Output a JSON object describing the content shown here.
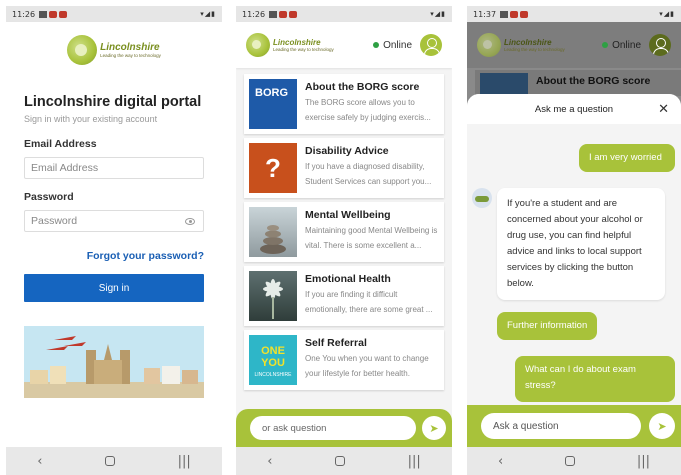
{
  "colors": {
    "brand_green": "#a8c23a",
    "primary_blue": "#1565c0",
    "link_blue": "#1a5fb4",
    "online_green": "#2ea043"
  },
  "logo": {
    "name": "Lincolnshire",
    "tagline": "Leading the way to technology"
  },
  "nav_icons": [
    "back-icon",
    "home-icon",
    "recents-icon"
  ],
  "screen1": {
    "status_time": "11:26",
    "title": "Lincolnshire digital portal",
    "subtitle": "Sign in with your existing account",
    "email_label": "Email Address",
    "email_placeholder": "Email Address",
    "password_label": "Password",
    "password_placeholder": "Password",
    "forgot_link": "Forgot your password?",
    "signin_button": "Sign in"
  },
  "screen2": {
    "status_time": "11:26",
    "online_label": "Online",
    "cards": [
      {
        "title": "About the BORG score",
        "desc": "The BORG score allows you to exercise safely by judging exercis...",
        "image": "borg-scale-image",
        "image_text": "BORG"
      },
      {
        "title": "Disability Advice",
        "desc": "If you have a diagnosed disability, Student Services can support you...",
        "image": "question-mark-image",
        "image_text": "?"
      },
      {
        "title": "Mental Wellbeing",
        "desc": "Maintaining good Mental Wellbeing is vital. There is some excellent a...",
        "image": "stacked-stones-image",
        "image_text": ""
      },
      {
        "title": "Emotional Health",
        "desc": "If you are finding it difficult emotionally, there are some great ...",
        "image": "flower-image",
        "image_text": ""
      },
      {
        "title": "Self Referral",
        "desc": "One You when you want to change your lifestyle for better health.",
        "image": "one-you-lincolnshire-image",
        "image_text": "ONE YOU",
        "image_subtext": "LINCOLNSHIRE"
      }
    ],
    "ask_placeholder": "or ask question"
  },
  "screen3": {
    "status_time": "11:37",
    "online_label": "Online",
    "bg_card_title": "About the BORG score",
    "chat_title": "Ask me a question",
    "messages": [
      {
        "from": "user",
        "text": "I am very worried"
      },
      {
        "from": "bot",
        "text": "If you're a student and are concerned about your alcohol or drug use, you can find helpful advice and links to local support services by clicking the button below."
      },
      {
        "from": "button",
        "text": "Further information"
      },
      {
        "from": "user",
        "text": "What can I do about exam stress?"
      }
    ],
    "ask_placeholder": "Ask a question"
  }
}
